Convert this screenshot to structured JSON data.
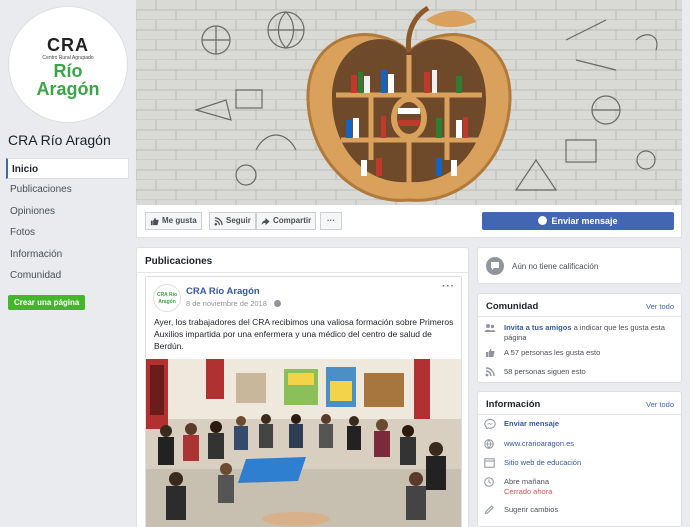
{
  "sidebar": {
    "logo": {
      "line1": "CRA",
      "tagline": "Centro Rural Agrupado",
      "line2": "Río",
      "line3": "Aragón"
    },
    "page_name": "CRA Río Aragón",
    "nav": [
      "Inicio",
      "Publicaciones",
      "Opiniones",
      "Fotos",
      "Información",
      "Comunidad"
    ],
    "active_index": 0,
    "create_page_label": "Crear una página"
  },
  "actions": {
    "like_label": "Me gusta",
    "follow_label": "Seguir",
    "share_label": "Compartir",
    "more_label": "···",
    "send_message_label": "Enviar mensaje"
  },
  "posts": {
    "section_title": "Publicaciones",
    "post": {
      "avatar_text": "CRA Río Aragón",
      "author": "CRA Río Aragón",
      "date": "8 de noviembre de 2018 ·",
      "more": "···",
      "text": "Ayer, los trabajadores del CRA recibimos una valiosa formación sobre Primeros Auxilios impartida por una enfermera y una médico del centro de salud de Berdún."
    }
  },
  "rating": {
    "text": "Aún no tiene calificación"
  },
  "community": {
    "title": "Comunidad",
    "see_all": "Ver todo",
    "invite_link": "Invita a tus amigos",
    "invite_rest": " a indicar que les gusta esta página",
    "likes": "A 57 personas les gusta esto",
    "followers": "58 personas siguen esto"
  },
  "info": {
    "title": "Información",
    "see_all": "Ver todo",
    "send_message": "Enviar mensaje",
    "website": "www.crarioaragon.es",
    "category": "Sitio web de educación",
    "opens": "Abre mañana",
    "status": "Cerrado ahora",
    "suggest": "Sugerir cambios"
  },
  "colors": {
    "accent": "#4267b2",
    "brand_green": "#3ca447",
    "closed_red": "#d35454",
    "create_green": "#42b72a"
  }
}
